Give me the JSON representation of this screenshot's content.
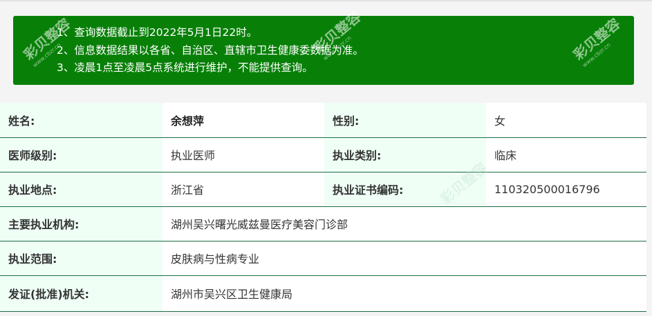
{
  "notice": {
    "lines": [
      "1、查询数据截止到2022年5月1日22时。",
      "2、信息数据结果以各省、自治区、直辖市卫生健康委数据为准。",
      "3、凌晨1点至凌晨5点系统进行维护，不能提供查询。"
    ]
  },
  "doctor": {
    "name_label": "姓名:",
    "name": "余想萍",
    "gender_label": "性别:",
    "gender": "女",
    "level_label": "医师级别:",
    "level": "执业医师",
    "category_label": "执业类别:",
    "category": "临床",
    "location_label": "执业地点:",
    "location": "浙江省",
    "cert_label": "执业证书编码:",
    "cert": "110320500016796",
    "institution_label": "主要执业机构:",
    "institution": "湖州吴兴曙光威兹曼医疗美容门诊部",
    "scope_label": "执业范围:",
    "scope": "皮肤病与性病专业",
    "authority_label": "发证(批准)机关:",
    "authority": "湖州市吴兴区卫生健康局"
  },
  "watermark": {
    "text": "彩贝整容",
    "url": "www.cbzr.cn"
  }
}
